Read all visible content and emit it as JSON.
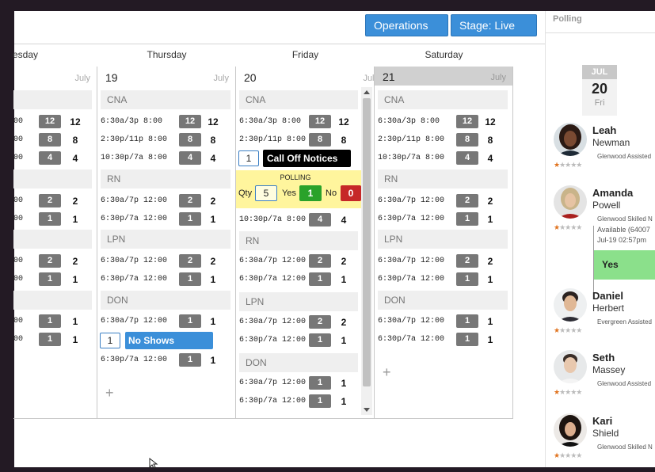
{
  "toolbar": {
    "operations_label": "Operations",
    "stage_label": "Stage: Live"
  },
  "side_panel": {
    "title": "Polling",
    "date_month": "JUL",
    "date_day": "20",
    "date_weekday": "Fri"
  },
  "days": {
    "wednesday_partial": "esday",
    "thursday": "Thursday",
    "friday": "Friday",
    "saturday": "Saturday"
  },
  "columns": {
    "wednesday": {
      "month": "July",
      "rows": [
        {
          "badge": "12",
          "count": "12"
        },
        {
          "badge": "8",
          "count": "8"
        },
        {
          "badge": "4",
          "count": "4"
        },
        {
          "badge": "2",
          "count": "2"
        },
        {
          "badge": "1",
          "count": "1"
        },
        {
          "badge": "2",
          "count": "2"
        },
        {
          "badge": "1",
          "count": "1"
        },
        {
          "badge": "1",
          "count": "1"
        },
        {
          "badge": "1",
          "count": "1"
        }
      ],
      "shift_fragment": "00"
    },
    "thursday": {
      "date": "19",
      "month": "July",
      "cats": [
        "CNA",
        "RN",
        "LPN",
        "DON"
      ],
      "rows": [
        {
          "time": "6:30a/3p 8:00",
          "badge": "12",
          "count": "12"
        },
        {
          "time": "2:30p/11p 8:00",
          "badge": "8",
          "count": "8"
        },
        {
          "time": "10:30p/7a 8:00",
          "badge": "4",
          "count": "4"
        },
        {
          "time": "6:30a/7p 12:00",
          "badge": "2",
          "count": "2"
        },
        {
          "time": "6:30p/7a 12:00",
          "badge": "1",
          "count": "1"
        },
        {
          "time": "6:30a/7p 12:00",
          "badge": "2",
          "count": "2"
        },
        {
          "time": "6:30p/7a 12:00",
          "badge": "1",
          "count": "1"
        },
        {
          "time": "6:30a/7p 12:00",
          "badge": "1",
          "count": "1"
        },
        {
          "time": "6:30p/7a 12:00",
          "badge": "1",
          "count": "1"
        }
      ],
      "no_shows": {
        "qty": "1",
        "label": "No Shows"
      },
      "add_label": "+"
    },
    "friday": {
      "date": "20",
      "month": "July",
      "cats": [
        "CNA",
        "RN",
        "LPN",
        "DON"
      ],
      "rows": [
        {
          "time": "6:30a/3p 8:00",
          "badge": "12",
          "count": "12"
        },
        {
          "time": "2:30p/11p 8:00",
          "badge": "8",
          "count": "8"
        },
        {
          "time": "10:30p/7a 8:00",
          "badge": "4",
          "count": "4"
        },
        {
          "time": "6:30a/7p 12:00",
          "badge": "2",
          "count": "2"
        },
        {
          "time": "6:30p/7a 12:00",
          "badge": "1",
          "count": "1"
        },
        {
          "time": "6:30a/7p 12:00",
          "badge": "2",
          "count": "2"
        },
        {
          "time": "6:30p/7a 12:00",
          "badge": "1",
          "count": "1"
        },
        {
          "time": "6:30a/7p 12:00",
          "badge": "1",
          "count": "1"
        },
        {
          "time": "6:30p/7a 12:00",
          "badge": "1",
          "count": "1"
        }
      ],
      "call_off": {
        "qty": "1",
        "label": "Call Off Notices"
      },
      "polling": {
        "title": "POLLING",
        "qty_label": "Qty",
        "qty": "5",
        "yes_label": "Yes",
        "yes": "1",
        "no_label": "No",
        "no": "0"
      }
    },
    "saturday": {
      "date": "21",
      "month": "July",
      "cats": [
        "CNA",
        "RN",
        "LPN",
        "DON"
      ],
      "rows": [
        {
          "time": "6:30a/3p 8:00",
          "badge": "12",
          "count": "12"
        },
        {
          "time": "2:30p/11p 8:00",
          "badge": "8",
          "count": "8"
        },
        {
          "time": "10:30p/7a 8:00",
          "badge": "4",
          "count": "4"
        },
        {
          "time": "6:30a/7p 12:00",
          "badge": "2",
          "count": "2"
        },
        {
          "time": "6:30p/7a 12:00",
          "badge": "1",
          "count": "1"
        },
        {
          "time": "6:30a/7p 12:00",
          "badge": "2",
          "count": "2"
        },
        {
          "time": "6:30p/7a 12:00",
          "badge": "1",
          "count": "1"
        },
        {
          "time": "6:30a/7p 12:00",
          "badge": "1",
          "count": "1"
        },
        {
          "time": "6:30p/7a 12:00",
          "badge": "1",
          "count": "1"
        }
      ],
      "add_label": "+"
    }
  },
  "candidates": [
    {
      "first": "Leah",
      "last": "Newman",
      "info": "Glenwood  Assisted",
      "rating": 1
    },
    {
      "first": "Amanda",
      "last": "Powell",
      "info": "Glenwood  Skilled N",
      "rating": 1,
      "response": {
        "status": "Available (64007",
        "time": "Jul-19 02:57pm",
        "answer": "Yes"
      }
    },
    {
      "first": "Daniel",
      "last": "Herbert",
      "info": "Evergreen  Assisted",
      "rating": 1
    },
    {
      "first": "Seth",
      "last": "Massey",
      "info": "Glenwood  Assisted",
      "rating": 1
    },
    {
      "first": "Kari",
      "last": "Shield",
      "info": "Glenwood  Skilled N",
      "rating": 1
    }
  ],
  "colors": {
    "accent": "#3b8fd9",
    "badge": "#777777",
    "yes": "#2aa22a",
    "no": "#c62828",
    "polling_bg": "#fff59d",
    "answer_bg": "#8be08b"
  }
}
